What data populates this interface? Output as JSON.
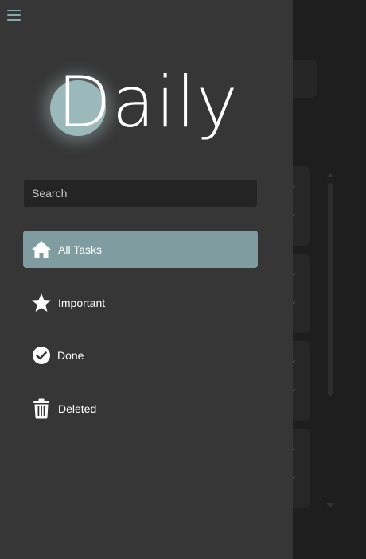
{
  "app": {
    "title": "Daily"
  },
  "search": {
    "placeholder": "Search"
  },
  "nav": {
    "items": [
      {
        "label": "All Tasks",
        "icon": "home-icon",
        "active": true
      },
      {
        "label": "Important",
        "icon": "star-icon",
        "active": false
      },
      {
        "label": "Done",
        "icon": "check-circle-icon",
        "active": false
      },
      {
        "label": "Deleted",
        "icon": "trash-icon",
        "active": false
      }
    ]
  },
  "colors": {
    "drawer_bg": "#363636",
    "accent": "#7f9da1",
    "menu_icon": "#86a9ad",
    "search_bg": "#242424"
  }
}
